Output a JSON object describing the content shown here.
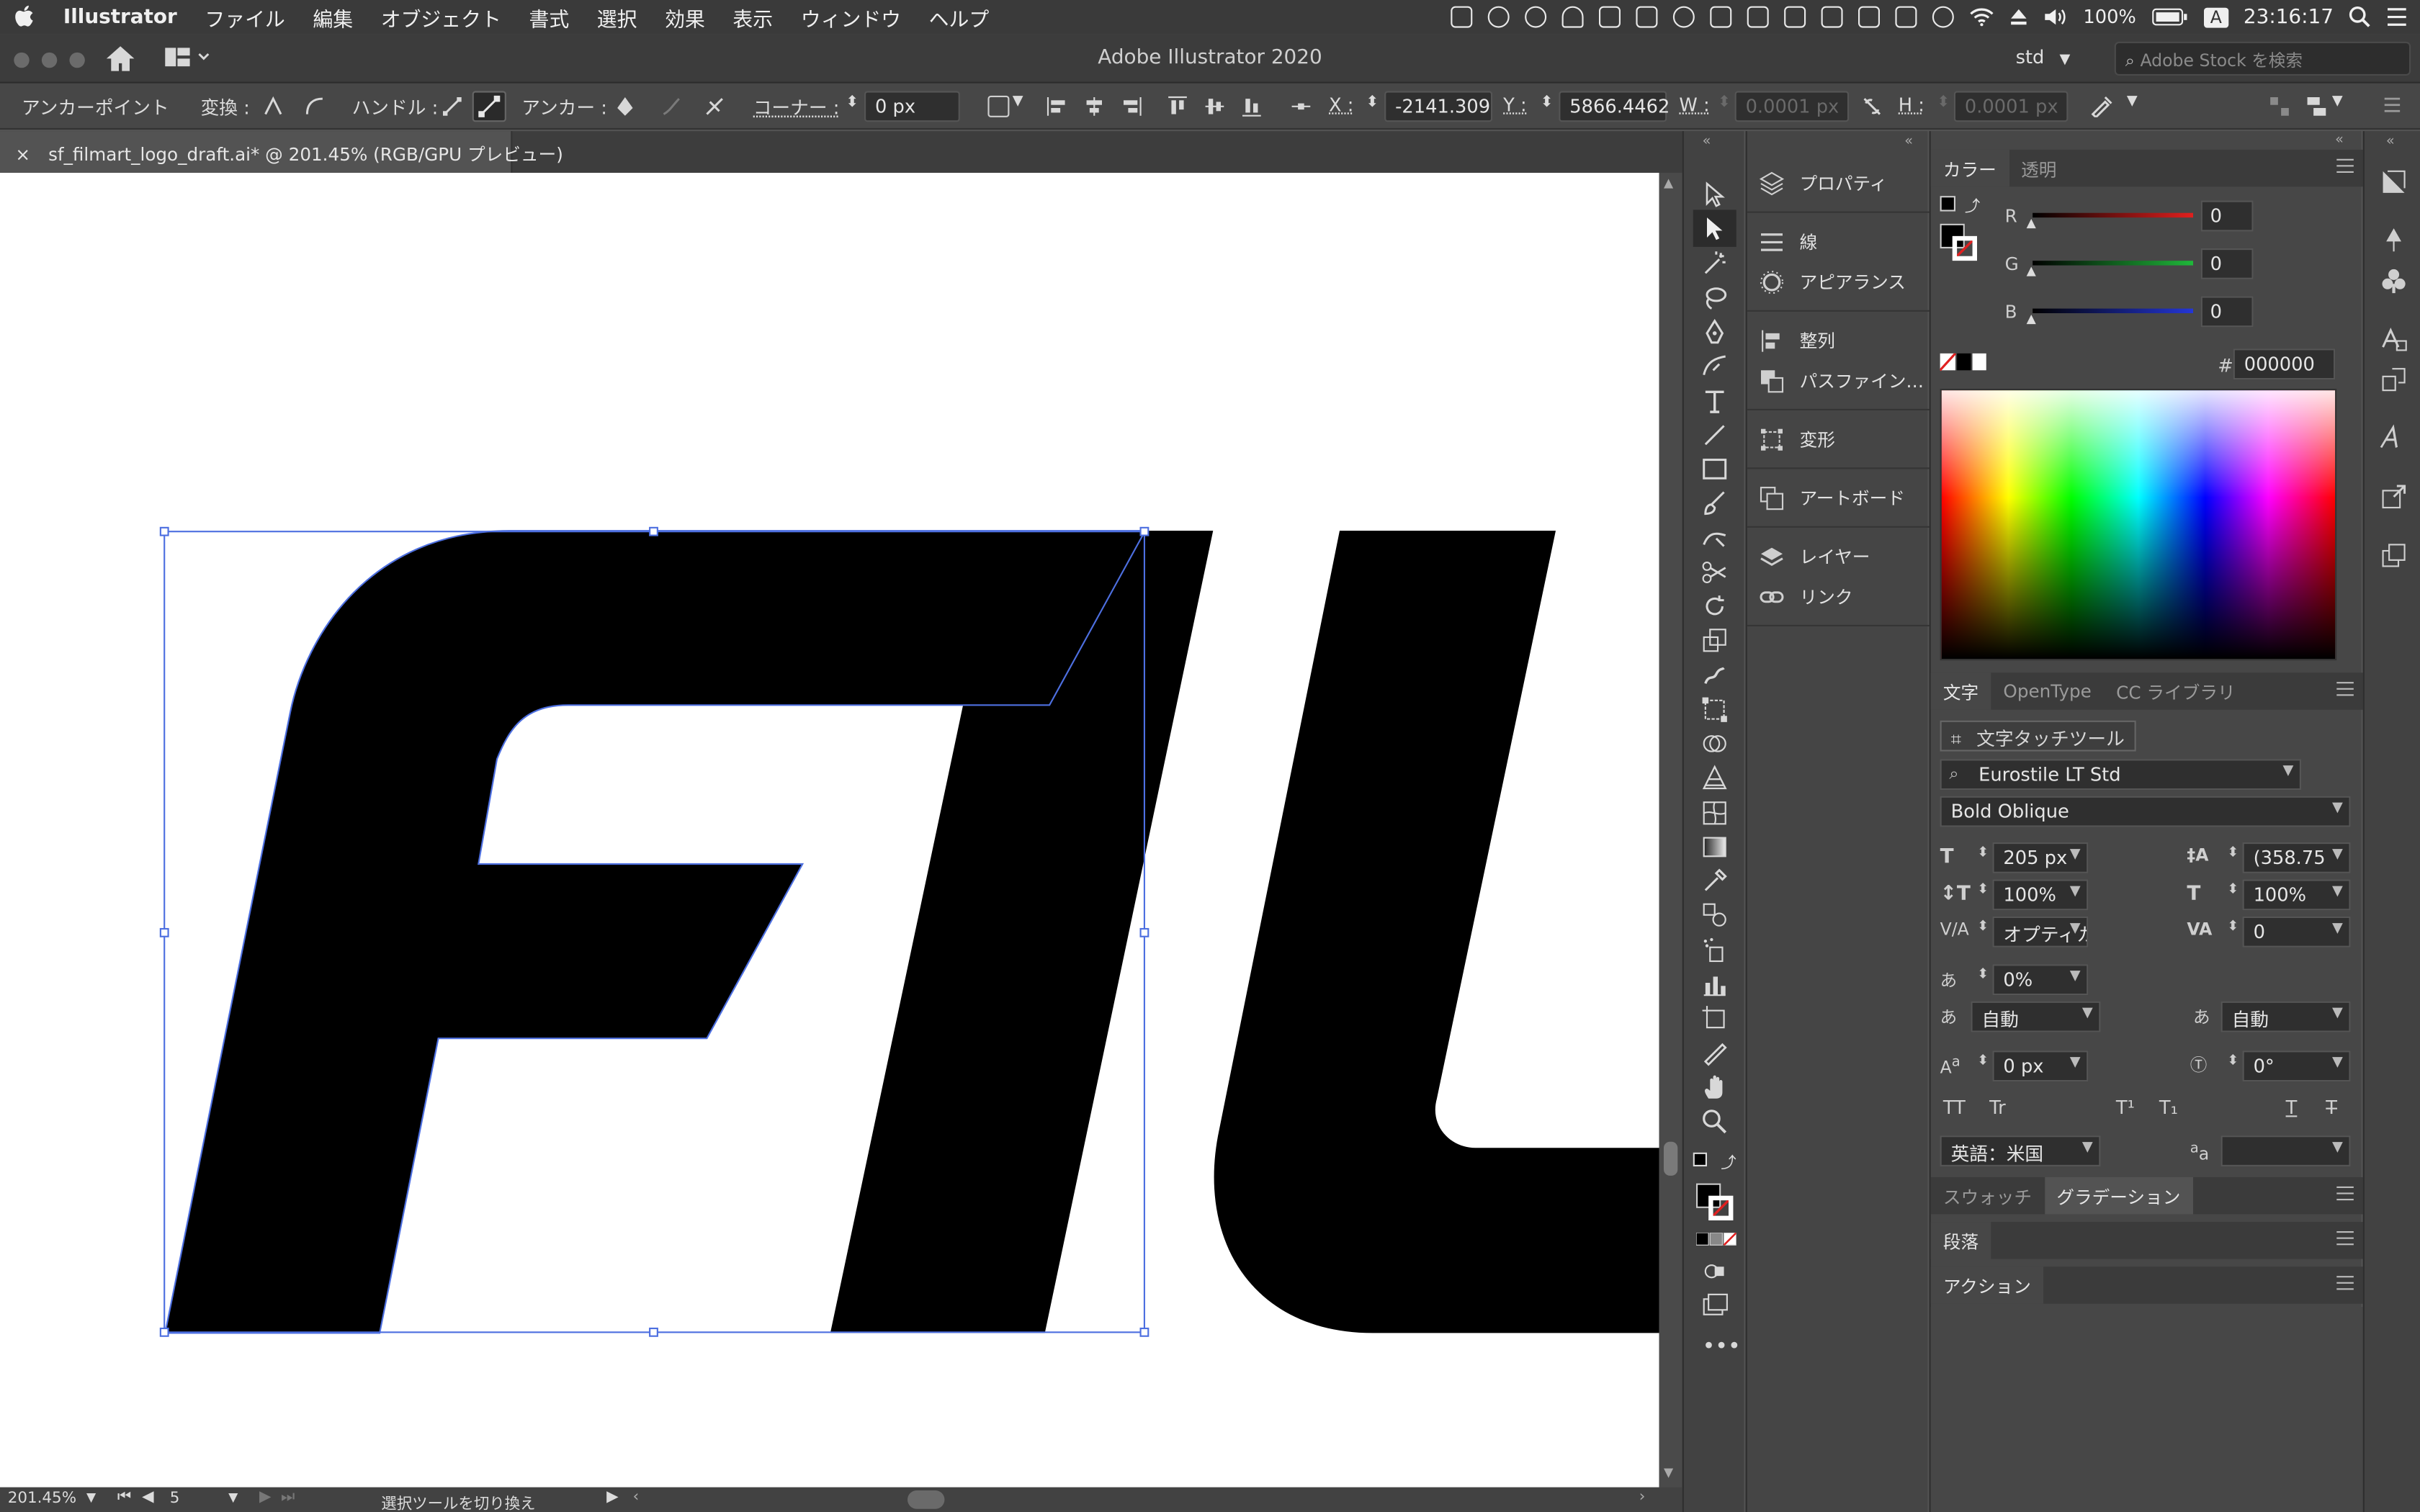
{
  "menubar": {
    "app": "Illustrator",
    "items": [
      "ファイル",
      "編集",
      "オブジェクト",
      "書式",
      "選択",
      "効果",
      "表示",
      "ウィンドウ",
      "ヘルプ"
    ],
    "battery": "100%",
    "clock": "23:16:17",
    "input_indicator": "A"
  },
  "window": {
    "title": "Adobe Illustrator 2020",
    "workspace": "std",
    "stock_placeholder": "Adobe Stock を検索"
  },
  "control_bar": {
    "mode_label": "アンカーポイント",
    "convert_label": "変換 :",
    "handle_label": "ハンドル :",
    "anchor_label": "アンカー :",
    "corner_label": "コーナー :",
    "corner_value": "0 px",
    "x_label": "X :",
    "x_value": "-2141.309",
    "y_label": "Y :",
    "y_value": "5866.4462",
    "w_label": "W :",
    "w_value": "0.0001 px",
    "h_label": "H :",
    "h_value": "0.0001 px"
  },
  "document": {
    "tab_title": "sf_filmart_logo_draft.ai* @ 201.45% (RGB/GPU プレビュー)",
    "close_glyph": "×"
  },
  "status_bar": {
    "zoom": "201.45%",
    "artboard": "5",
    "message": "選択ツールを切り換え"
  },
  "tools": {
    "names": [
      "selection-tool",
      "direct-selection-tool",
      "magic-wand-tool",
      "lasso-tool",
      "pen-tool",
      "curvature-tool",
      "type-tool",
      "line-tool",
      "rectangle-tool",
      "paintbrush-tool",
      "shaper-tool",
      "scissors-tool",
      "rotate-tool",
      "scale-tool",
      "warp-tool",
      "free-transform-tool",
      "shape-builder-tool",
      "perspective-grid-tool",
      "mesh-tool",
      "gradient-tool",
      "eyedropper-tool",
      "blend-tool",
      "symbol-sprayer-tool",
      "column-graph-tool",
      "artboard-tool",
      "slice-tool",
      "hand-tool",
      "zoom-tool"
    ]
  },
  "properties_panel": {
    "items": [
      {
        "name": "properties",
        "label": "プロパティ"
      },
      {
        "name": "stroke",
        "label": "線"
      },
      {
        "name": "appearance",
        "label": "アピアランス"
      },
      {
        "name": "align",
        "label": "整列"
      },
      {
        "name": "pathfinder",
        "label": "パスファイン…"
      },
      {
        "name": "transform",
        "label": "変形"
      },
      {
        "name": "artboards",
        "label": "アートボード"
      },
      {
        "name": "layers",
        "label": "レイヤー"
      },
      {
        "name": "links",
        "label": "リンク"
      }
    ]
  },
  "color_panel": {
    "tabs": [
      "カラー",
      "透明"
    ],
    "channels": [
      {
        "label": "R",
        "value": "0",
        "color": "#e0201e"
      },
      {
        "label": "G",
        "value": "0",
        "color": "#1fb83a"
      },
      {
        "label": "B",
        "value": "0",
        "color": "#2436d6"
      }
    ],
    "hex_label": "#",
    "hex_value": "000000"
  },
  "character_panel": {
    "tabs": [
      "文字",
      "OpenType",
      "CC ライブラリ"
    ],
    "touch_tool_label": "文字タッチツール",
    "font_family": "Eurostile LT Std",
    "font_style": "Bold Oblique",
    "font_size": "205 px",
    "leading": "(358.75",
    "vertical_scale": "100%",
    "horizontal_scale": "100%",
    "kerning": "オプティカル",
    "tracking": "0",
    "tsume": "0%",
    "aki_left": "自動",
    "aki_right": "自動",
    "baseline_shift": "0 px",
    "rotation": "0°",
    "language": "英語：米国",
    "style_buttons": [
      "TT",
      "Tr",
      "T¹",
      "T₁",
      "T",
      "T"
    ]
  },
  "bottom_panels": {
    "swatch_tab": "スウォッチ",
    "gradient_tab": "グラデーション",
    "paragraph_tab": "段落",
    "actions_tab": "アクション"
  },
  "colors": {
    "selection": "#4d6fe0",
    "artwork": "#000000"
  }
}
